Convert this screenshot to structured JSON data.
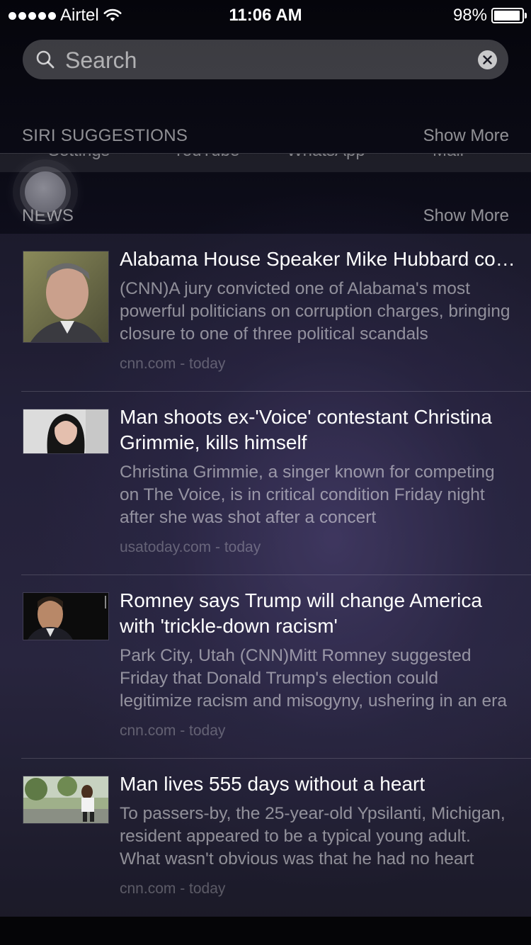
{
  "status_bar": {
    "carrier": "Airtel",
    "time": "11:06 AM",
    "battery_percent": "98%"
  },
  "search": {
    "placeholder": "Search",
    "value": ""
  },
  "siri_suggestions": {
    "title": "SIRI SUGGESTIONS",
    "show_more": "Show More",
    "apps": [
      "Settings",
      "YouTube",
      "WhatsApp",
      "Mail"
    ]
  },
  "news": {
    "title": "NEWS",
    "show_more": "Show More",
    "items": [
      {
        "headline": "Alabama House Speaker Mike Hubbard convicted",
        "snippet": "(CNN)A jury convicted one of Alabama's most powerful politicians on corruption charges, bringing closure to one of three political scandals",
        "source": "cnn.com - today"
      },
      {
        "headline": "Man shoots ex-'Voice' contestant Christina Grimmie, kills himself",
        "snippet": "Christina Grimmie, a singer known for competing on The Voice, is in critical condition Friday night after she was shot after a concert",
        "source": "usatoday.com - today"
      },
      {
        "headline": "Romney says Trump will change America with 'trickle-down racism'",
        "snippet": "Park City, Utah (CNN)Mitt Romney suggested Friday that Donald Trump's election could legitimize racism and misogyny, ushering in an era",
        "source": "cnn.com - today"
      },
      {
        "headline": "Man lives 555 days without a heart",
        "snippet": "To passers-by, the 25-year-old Ypsilanti, Michigan, resident appeared to be a typical young adult. What wasn't obvious was that he had no heart",
        "source": "cnn.com - today"
      }
    ]
  },
  "colors": {
    "background": "#07070f",
    "accent_purple": "#4e4278",
    "secondary_text": "#8c8a9c"
  }
}
